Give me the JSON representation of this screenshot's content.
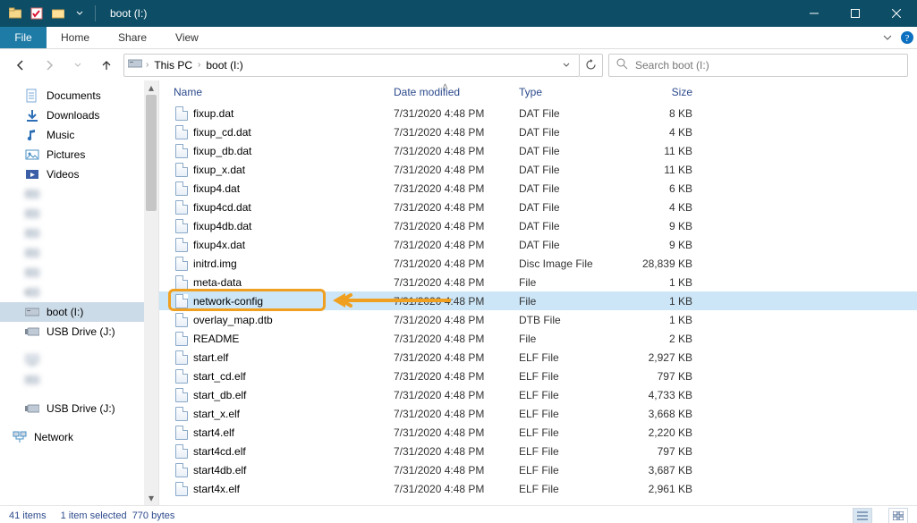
{
  "window_title": "boot (I:)",
  "ribbon": {
    "file": "File",
    "tabs": [
      "Home",
      "Share",
      "View"
    ]
  },
  "breadcrumbs": [
    "This PC",
    "boot (I:)"
  ],
  "search_placeholder": "Search boot (I:)",
  "columns": {
    "name": "Name",
    "date": "Date modified",
    "type": "Type",
    "size": "Size"
  },
  "nav_quick": [
    {
      "label": "Documents",
      "icon": "documents"
    },
    {
      "label": "Downloads",
      "icon": "downloads"
    },
    {
      "label": "Music",
      "icon": "music"
    },
    {
      "label": "Pictures",
      "icon": "pictures"
    },
    {
      "label": "Videos",
      "icon": "videos"
    }
  ],
  "nav_drives_a": [
    {
      "label": "",
      "icon": "drive",
      "blur": true
    },
    {
      "label": "",
      "icon": "drive",
      "blur": true
    },
    {
      "label": "",
      "icon": "drive",
      "blur": true
    },
    {
      "label": "",
      "icon": "drive",
      "blur": true
    },
    {
      "label": "",
      "icon": "drive",
      "blur": true
    },
    {
      "label": "",
      "icon": "usb",
      "blur": true
    }
  ],
  "nav_sel": {
    "label": "boot (I:)",
    "icon": "drive"
  },
  "nav_after": [
    {
      "label": "USB Drive (J:)",
      "icon": "usb"
    }
  ],
  "nav_group2_blur": [
    {
      "label": "",
      "icon": "pc",
      "blur": true
    },
    {
      "label": "",
      "icon": "drive",
      "blur": true
    }
  ],
  "nav_group2": [
    {
      "label": "USB Drive (J:)",
      "icon": "usb"
    }
  ],
  "nav_network": {
    "label": "Network",
    "icon": "network"
  },
  "files": [
    {
      "name": "fixup.dat",
      "date": "7/31/2020 4:48 PM",
      "type": "DAT File",
      "size": "8 KB"
    },
    {
      "name": "fixup_cd.dat",
      "date": "7/31/2020 4:48 PM",
      "type": "DAT File",
      "size": "4 KB"
    },
    {
      "name": "fixup_db.dat",
      "date": "7/31/2020 4:48 PM",
      "type": "DAT File",
      "size": "11 KB"
    },
    {
      "name": "fixup_x.dat",
      "date": "7/31/2020 4:48 PM",
      "type": "DAT File",
      "size": "11 KB"
    },
    {
      "name": "fixup4.dat",
      "date": "7/31/2020 4:48 PM",
      "type": "DAT File",
      "size": "6 KB"
    },
    {
      "name": "fixup4cd.dat",
      "date": "7/31/2020 4:48 PM",
      "type": "DAT File",
      "size": "4 KB"
    },
    {
      "name": "fixup4db.dat",
      "date": "7/31/2020 4:48 PM",
      "type": "DAT File",
      "size": "9 KB"
    },
    {
      "name": "fixup4x.dat",
      "date": "7/31/2020 4:48 PM",
      "type": "DAT File",
      "size": "9 KB"
    },
    {
      "name": "initrd.img",
      "date": "7/31/2020 4:48 PM",
      "type": "Disc Image File",
      "size": "28,839 KB"
    },
    {
      "name": "meta-data",
      "date": "7/31/2020 4:48 PM",
      "type": "File",
      "size": "1 KB"
    },
    {
      "name": "network-config",
      "date": "7/31/2020 4:48 PM",
      "type": "File",
      "size": "1 KB",
      "selected": true,
      "highlighted": true
    },
    {
      "name": "overlay_map.dtb",
      "date": "7/31/2020 4:48 PM",
      "type": "DTB File",
      "size": "1 KB"
    },
    {
      "name": "README",
      "date": "7/31/2020 4:48 PM",
      "type": "File",
      "size": "2 KB"
    },
    {
      "name": "start.elf",
      "date": "7/31/2020 4:48 PM",
      "type": "ELF File",
      "size": "2,927 KB"
    },
    {
      "name": "start_cd.elf",
      "date": "7/31/2020 4:48 PM",
      "type": "ELF File",
      "size": "797 KB"
    },
    {
      "name": "start_db.elf",
      "date": "7/31/2020 4:48 PM",
      "type": "ELF File",
      "size": "4,733 KB"
    },
    {
      "name": "start_x.elf",
      "date": "7/31/2020 4:48 PM",
      "type": "ELF File",
      "size": "3,668 KB"
    },
    {
      "name": "start4.elf",
      "date": "7/31/2020 4:48 PM",
      "type": "ELF File",
      "size": "2,220 KB"
    },
    {
      "name": "start4cd.elf",
      "date": "7/31/2020 4:48 PM",
      "type": "ELF File",
      "size": "797 KB"
    },
    {
      "name": "start4db.elf",
      "date": "7/31/2020 4:48 PM",
      "type": "ELF File",
      "size": "3,687 KB"
    },
    {
      "name": "start4x.elf",
      "date": "7/31/2020 4:48 PM",
      "type": "ELF File",
      "size": "2,961 KB"
    }
  ],
  "status": {
    "items": "41 items",
    "selected": "1 item selected",
    "bytes": "770 bytes"
  }
}
